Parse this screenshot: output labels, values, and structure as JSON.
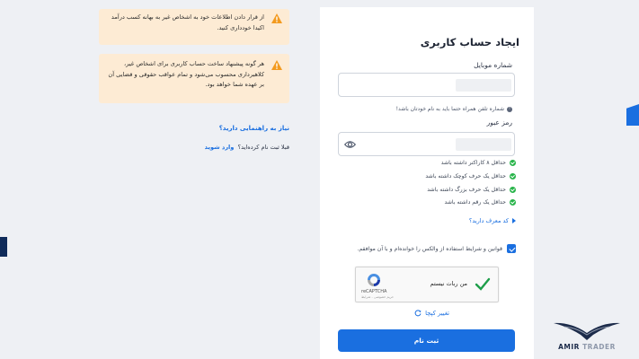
{
  "warnings": [
    {
      "text": "از قرار دادن اطلاعات خود به اشخاص غیر به بهانه کسب درآمد اکیدا خودداری کنید."
    },
    {
      "text": "هر گونه پیشنهاد ساخت حساب کاربری برای اشخاص غیر، کلاهبرداری محسوب می‌شود و تمام عواقب حقوقی و قضایی آن بر عهده شما خواهد بود."
    }
  ],
  "help_link": "نیاز به راهنمایی دارید؟",
  "already_registered": {
    "text": "قبلا ثبت نام کرده‌اید؟",
    "link": "وارد شوید"
  },
  "form": {
    "title": "ایجاد حساب کاربری",
    "mobile_label": "شماره موبایل",
    "mobile_hint": "شماره تلفن همراه حتما باید به نام خودتان باشد!",
    "password_label": "رمز عبور",
    "requirements": [
      "حداقل ۸ کاراکتر داشته باشد",
      "حداقل یک حرف کوچک داشته باشد",
      "حداقل یک حرف بزرگ داشته باشد",
      "حداقل یک رقم داشته باشد"
    ],
    "referral_link": "کد معرف دارید؟",
    "terms_text": "قوانین و شرایط استفاده از والکس را خوانده‌ام و با آن موافقم.",
    "captcha": {
      "label": "من ربات نیستم",
      "brand": "reCAPTCHA",
      "terms": "حریم خصوصی - شرایط"
    },
    "change_captcha": "تغییر کپچا",
    "submit_label": "ثبت نام"
  },
  "brand": {
    "name_part1": "AMIR",
    "name_part2": "TRADER"
  },
  "colors": {
    "accent": "#1a6fe0",
    "warning_bg": "#fdebd4",
    "success": "#28b44a",
    "warning_icon": "#f39a1e"
  }
}
